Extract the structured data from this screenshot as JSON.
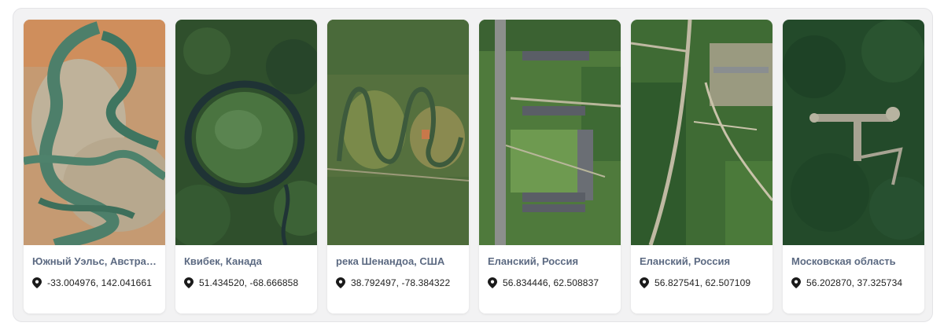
{
  "cards": [
    {
      "title": "Южный Уэльс, Австрал...",
      "coords": "-33.004976, 142.041661"
    },
    {
      "title": "Квибек, Канада",
      "coords": "51.434520, -68.666858"
    },
    {
      "title": "река Шенандоа, США",
      "coords": "38.792497, -78.384322"
    },
    {
      "title": "Еланский, Россия",
      "coords": "56.834446, 62.508837"
    },
    {
      "title": "Еланский, Россия",
      "coords": "56.827541, 62.507109"
    },
    {
      "title": "Московская область",
      "coords": "56.202870, 37.325734"
    }
  ],
  "icons": {
    "location": "map-pin-icon"
  }
}
